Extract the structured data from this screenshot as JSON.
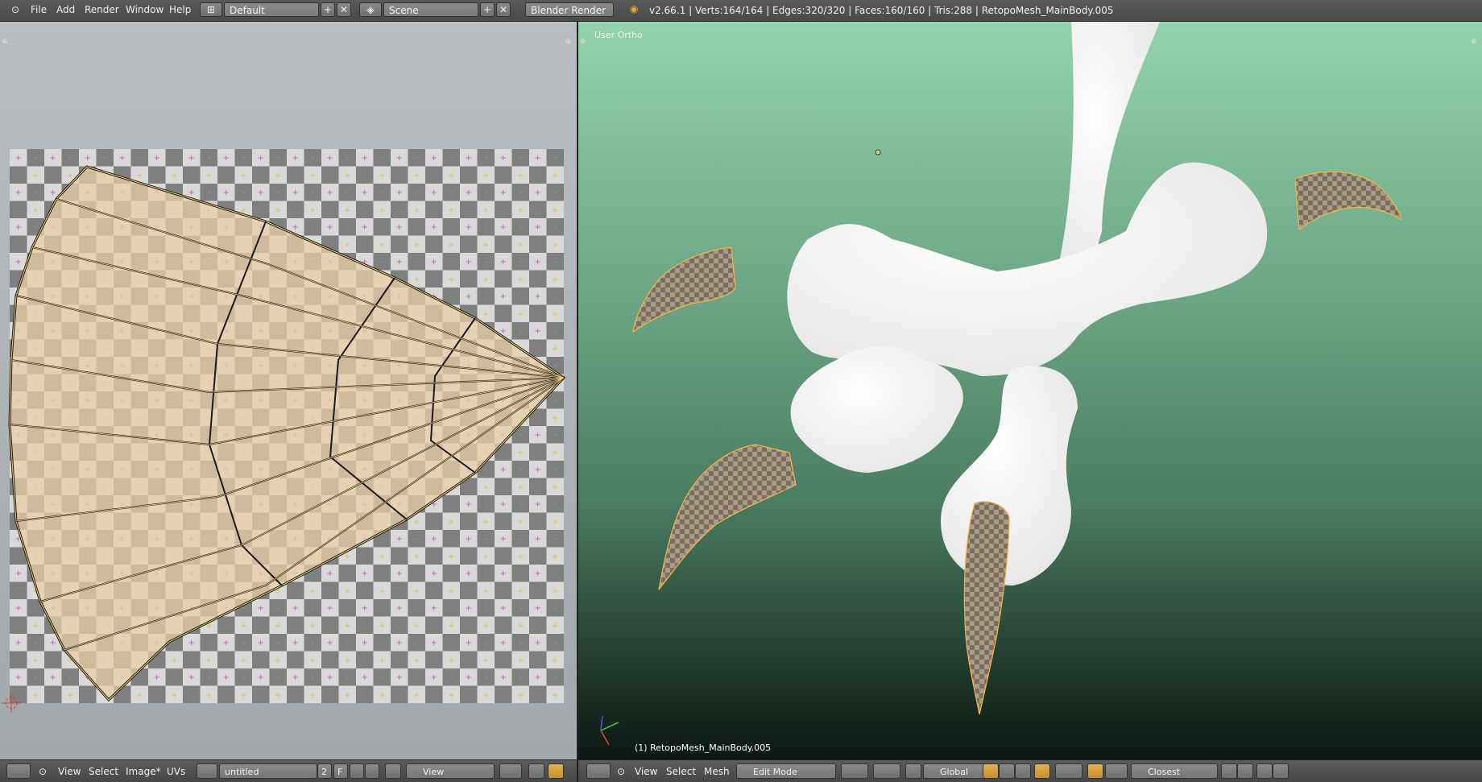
{
  "topbar": {
    "menu": [
      "File",
      "Add",
      "Render",
      "Window",
      "Help"
    ],
    "screen_layout": "Default",
    "scene": "Scene",
    "render_engine": "Blender Render",
    "stats": "v2.66.1 | Verts:164/164 | Edges:320/320 | Faces:160/160 | Tris:288 | RetopoMesh_MainBody.005"
  },
  "uv_editor": {
    "menu": [
      "View",
      "Select",
      "Image*",
      "UVs"
    ],
    "image_name": "untitled",
    "image_users": "2",
    "fake_user": "F",
    "view_mode": "View"
  },
  "viewport": {
    "view_label": "User Ortho",
    "object_label": "(1) RetopoMesh_MainBody.005",
    "menu": [
      "View",
      "Select",
      "Mesh"
    ],
    "mode": "Edit Mode",
    "orientation": "Global",
    "snap_target": "Closest"
  },
  "colors": {
    "selection_edge": "#f5b544",
    "uv_fill": "#e8cfa6",
    "viewport_top": "#94d2ae",
    "viewport_bottom": "#0c1712"
  }
}
